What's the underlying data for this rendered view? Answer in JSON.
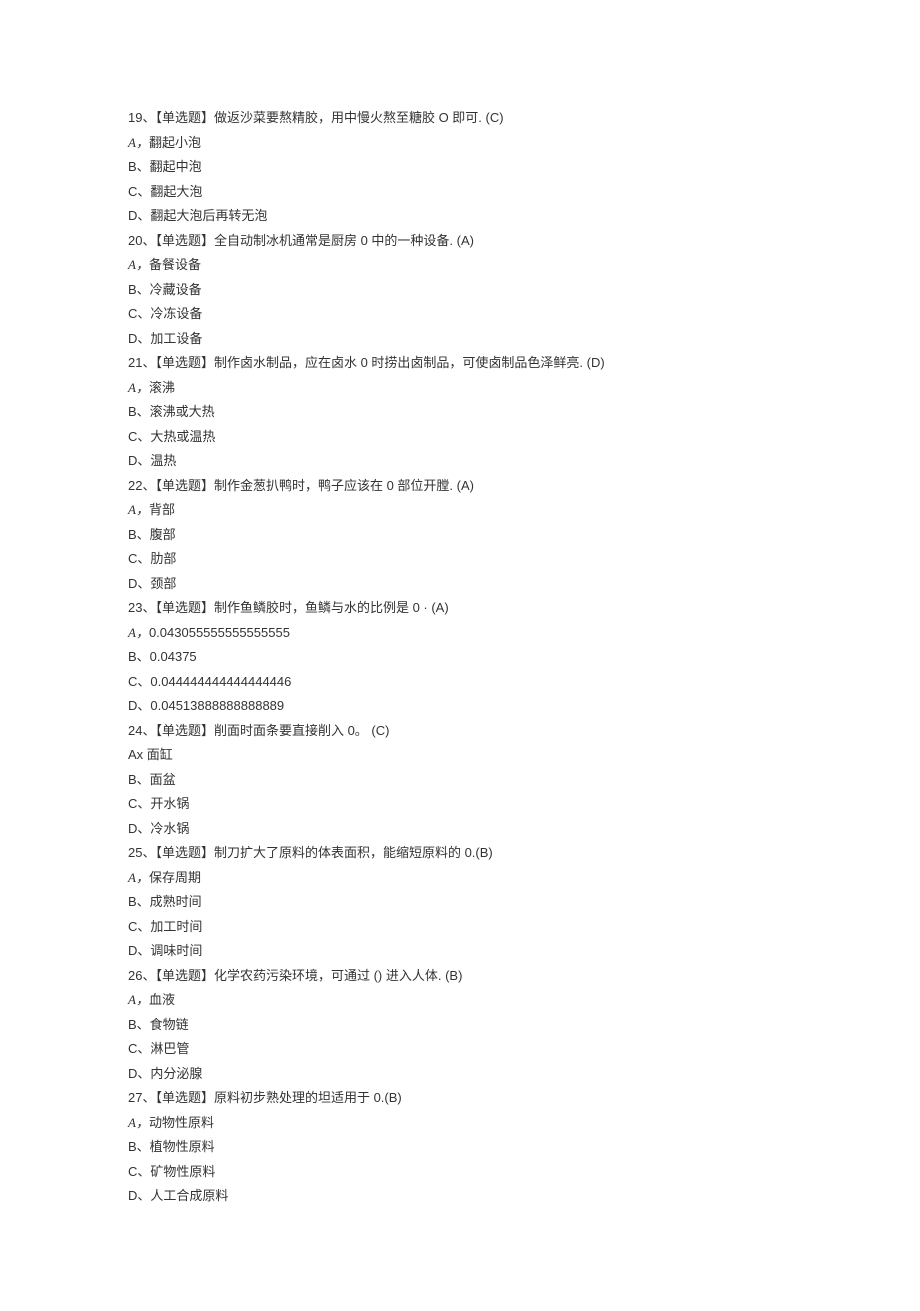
{
  "questions": [
    {
      "id": "q19",
      "text": "19、【单选题】做返沙菜要熬精胶，用中慢火熬至糖胶 O 即可. (C)",
      "options": [
        {
          "prefix": "A，",
          "text": "翻起小泡",
          "italic": true
        },
        {
          "prefix": "B、",
          "text": "翻起中泡"
        },
        {
          "prefix": "C、",
          "text": "翻起大泡"
        },
        {
          "prefix": "D、",
          "text": "翻起大泡后再转无泡"
        }
      ]
    },
    {
      "id": "q20",
      "text": "20、【单选题】全自动制冰机通常是厨房 0 中的一种设备. (A)",
      "options": [
        {
          "prefix": "A，",
          "text": "备餐设备",
          "italic": true
        },
        {
          "prefix": "B、",
          "text": "冷藏设备"
        },
        {
          "prefix": "C、",
          "text": "冷冻设备"
        },
        {
          "prefix": "D、",
          "text": "加工设备"
        }
      ]
    },
    {
      "id": "q21",
      "text": "21、【单选题】制作卤水制品，应在卤水 0 时捞出卤制品，可使卤制品色泽鲜亮. (D)",
      "options": [
        {
          "prefix": "A，",
          "text": "滚沸",
          "italic": true
        },
        {
          "prefix": "B、",
          "text": "滚沸或大热"
        },
        {
          "prefix": "C、",
          "text": "大热或温热"
        },
        {
          "prefix": "D、",
          "text": "温热"
        }
      ]
    },
    {
      "id": "q22",
      "text": "22、【单选题】制作金葱扒鸭时，鸭子应该在 0 部位开膛. (A)",
      "options": [
        {
          "prefix": "A，",
          "text": "背部",
          "italic": true
        },
        {
          "prefix": "B、",
          "text": "腹部"
        },
        {
          "prefix": "C、",
          "text": "肋部"
        },
        {
          "prefix": "D、",
          "text": "颈部"
        }
      ]
    },
    {
      "id": "q23",
      "text": "23、【单选题】制作鱼鳞胶时，鱼鳞与水的比例是 0 ·  (A)",
      "options": [
        {
          "prefix": "A，",
          "text": "0.043055555555555555",
          "italic": true
        },
        {
          "prefix": "B、",
          "text": "0.04375"
        },
        {
          "prefix": "C、",
          "text": "0.044444444444444446"
        },
        {
          "prefix": "D、",
          "text": "0.04513888888888889"
        }
      ]
    },
    {
      "id": "q24",
      "text": "24、【单选题】削面时面条要直接削入 0。 (C)",
      "options": [
        {
          "prefix": "Ax ",
          "text": "面缸"
        },
        {
          "prefix": "B、",
          "text": "面盆"
        },
        {
          "prefix": "C、",
          "text": "开水锅"
        },
        {
          "prefix": "D、",
          "text": "冷水锅"
        }
      ]
    },
    {
      "id": "q25",
      "text": "25、【单选题】制刀扩大了原料的体表面积，能缩短原料的 0.(B)",
      "options": [
        {
          "prefix": "A，",
          "text": "保存周期",
          "italic": true
        },
        {
          "prefix": "B、",
          "text": "成熟时间"
        },
        {
          "prefix": "C、",
          "text": "加工时间"
        },
        {
          "prefix": "D、",
          "text": "调味时间"
        }
      ]
    },
    {
      "id": "q26",
      "text": "26、【单选题】化学农药污染环境，可通过 () 进入人体. (B)",
      "options": [
        {
          "prefix": "A，",
          "text": "血液",
          "italic": true
        },
        {
          "prefix": "B、",
          "text": "食物链"
        },
        {
          "prefix": "C、",
          "text": "淋巴管"
        },
        {
          "prefix": "D、",
          "text": "内分泌腺"
        }
      ]
    },
    {
      "id": "q27",
      "text": "27、【单选题】原料初步熟处理的坦适用于 0.(B)",
      "options": [
        {
          "prefix": "A，",
          "text": "动物性原料",
          "italic": true
        },
        {
          "prefix": "B、",
          "text": "植物性原料"
        },
        {
          "prefix": "C、",
          "text": "矿物性原料"
        },
        {
          "prefix": "D、",
          "text": "人工合成原料"
        }
      ]
    }
  ]
}
